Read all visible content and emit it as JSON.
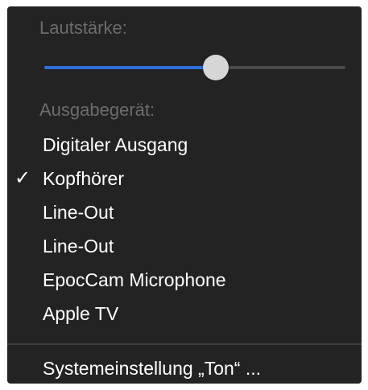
{
  "volume": {
    "label": "Lautstärke:",
    "level": 0.57
  },
  "output": {
    "label": "Ausgabegerät:",
    "devices": [
      {
        "label": "Digitaler Ausgang",
        "selected": false
      },
      {
        "label": "Kopfhörer",
        "selected": true
      },
      {
        "label": "Line-Out",
        "selected": false
      },
      {
        "label": "Line-Out",
        "selected": false
      },
      {
        "label": "EpocCam Microphone",
        "selected": false
      },
      {
        "label": "Apple TV",
        "selected": false
      }
    ],
    "checkmark": "✓"
  },
  "system_settings": {
    "label": "Systemeinstellung „Ton“ ..."
  },
  "colors": {
    "menu_background": "#232323",
    "accent": "#2f6fdc",
    "disabled_text": "#6c6c6c"
  }
}
